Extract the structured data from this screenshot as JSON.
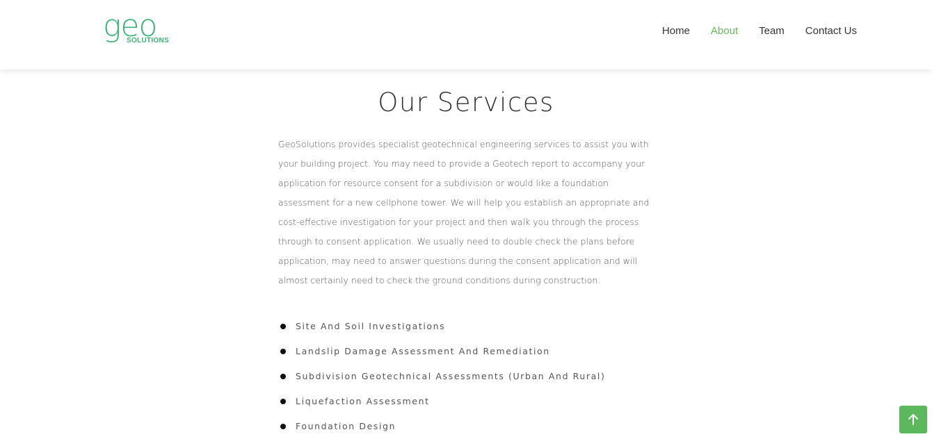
{
  "colors": {
    "brand_green": "#3bb273",
    "nav_active": "#63b95b",
    "nav_default": "#333333",
    "to_top_button": "#5cb85c"
  },
  "logo": {
    "wordmark": "geo",
    "subtitle": "SOLUTIONS"
  },
  "nav": {
    "items": [
      {
        "label": "Home",
        "active": false
      },
      {
        "label": "About",
        "active": true
      },
      {
        "label": "Team",
        "active": false
      },
      {
        "label": "Contact Us",
        "active": false
      }
    ]
  },
  "main": {
    "title": "Our Services",
    "intro": "GeoSolutions provides specialist geotechnical engineering services to assist you with your building project. You may need to provide a Geotech report to accompany your application for resource consent for a subdivision or would like a foundation assessment for a new cellphone tower. We will help you establish an appropriate and cost-effective investigation for your project and then walk you through the process through to consent application. We usually need to double check the plans before application, may need to answer questions during the consent application and will almost certainly need to check the ground conditions during construction.",
    "services": [
      "Site And Soil Investigations",
      "Landslip Damage Assessment And Remediation",
      "Subdivision Geotechnical Assessments (Urban And Rural)",
      "Liquefaction Assessment",
      "Foundation Design"
    ]
  },
  "icons": {
    "to_top": "arrow-up-icon",
    "list_bullet": "bullet-icon"
  }
}
